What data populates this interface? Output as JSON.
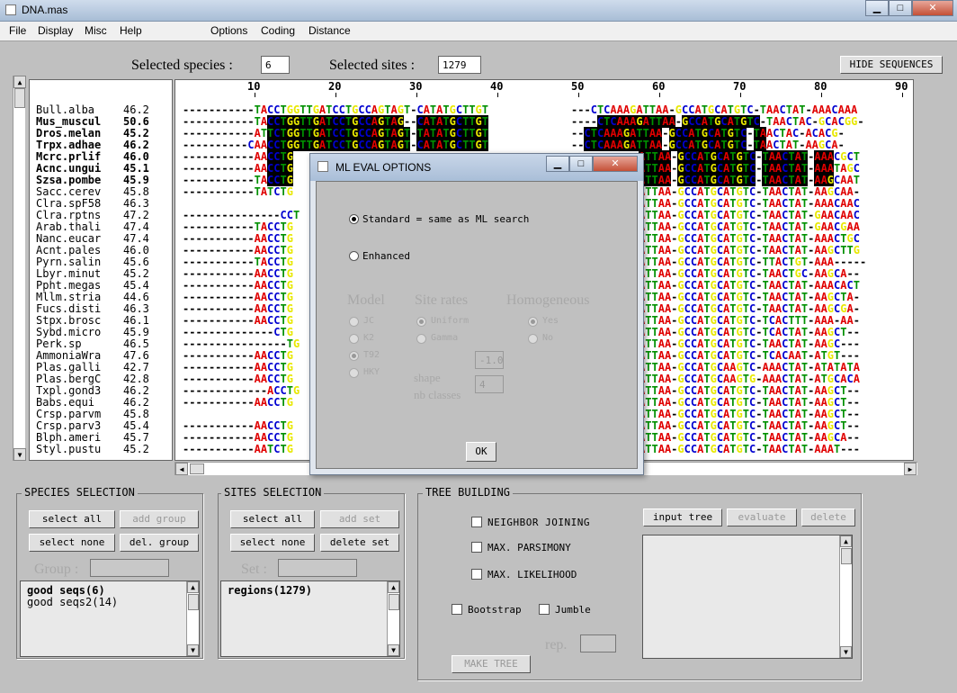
{
  "window": {
    "title": "DNA.mas",
    "minimize": "▁",
    "maximize": "□",
    "close": "✕"
  },
  "menu": {
    "items": [
      "File",
      "Display",
      "Misc",
      "Help",
      "Options",
      "Coding",
      "Distance"
    ]
  },
  "header": {
    "selected_species_label": "Selected species :",
    "selected_species_value": "6",
    "selected_sites_label": "Selected sites :",
    "selected_sites_value": "1279",
    "hide_sequences": "HIDE SEQUENCES"
  },
  "ruler": [
    "10",
    "20",
    "30",
    "40",
    "50",
    "60",
    "70",
    "80",
    "90"
  ],
  "species": [
    {
      "name": "Bull.alba",
      "score": "46.2",
      "bold": false
    },
    {
      "name": "Mus_muscul",
      "score": "50.6",
      "bold": true
    },
    {
      "name": "Dros.melan",
      "score": "45.2",
      "bold": true
    },
    {
      "name": "Trpx.adhae",
      "score": "46.2",
      "bold": true
    },
    {
      "name": "Mcrc.prlif",
      "score": "46.0",
      "bold": true
    },
    {
      "name": "Acnc.ungui",
      "score": "45.1",
      "bold": true
    },
    {
      "name": "Szsa.pombe",
      "score": "45.9",
      "bold": true
    },
    {
      "name": "Sacc.cerev",
      "score": "45.8",
      "bold": false
    },
    {
      "name": "Clra.spF58",
      "score": "46.3",
      "bold": false
    },
    {
      "name": "Clra.rptns",
      "score": "47.2",
      "bold": false
    },
    {
      "name": "Arab.thali",
      "score": "47.4",
      "bold": false
    },
    {
      "name": "Nanc.eucar",
      "score": "47.4",
      "bold": false
    },
    {
      "name": "Acnt.pales",
      "score": "46.0",
      "bold": false
    },
    {
      "name": "Pyrn.salin",
      "score": "45.6",
      "bold": false
    },
    {
      "name": "Lbyr.minut",
      "score": "45.2",
      "bold": false
    },
    {
      "name": "Ppht.megas",
      "score": "45.4",
      "bold": false
    },
    {
      "name": "Mllm.stria",
      "score": "44.6",
      "bold": false
    },
    {
      "name": "Fucs.disti",
      "score": "46.3",
      "bold": false
    },
    {
      "name": "Stpx.brosc",
      "score": "46.1",
      "bold": false
    },
    {
      "name": "Sybd.micro",
      "score": "45.9",
      "bold": false
    },
    {
      "name": "Perk.sp",
      "score": "46.5",
      "bold": false
    },
    {
      "name": "AmmoniaWra",
      "score": "47.6",
      "bold": false
    },
    {
      "name": "Plas.galli",
      "score": "42.7",
      "bold": false
    },
    {
      "name": "Plas.bergC",
      "score": "42.8",
      "bold": false
    },
    {
      "name": "Txpl.gond3",
      "score": "46.2",
      "bold": false
    },
    {
      "name": "Babs.equi",
      "score": "46.2",
      "bold": false
    },
    {
      "name": "Crsp.parvm",
      "score": "45.8",
      "bold": false
    },
    {
      "name": "Crsp.parv3",
      "score": "45.4",
      "bold": false
    },
    {
      "name": "Blph.ameri",
      "score": "45.7",
      "bold": false
    },
    {
      "name": "Styl.pustu",
      "score": "45.2",
      "bold": false
    }
  ],
  "sequences": {
    "left": [
      "-----------TACCTGGTTGATCCTGCCAGTAGT-CATATGCTTGT",
      "-----------TACCTGGTTGATCCTGCCAGTAG--CATATGCTTGT",
      "-----------ATTCTGGTTGATCCTGCCAGTAGT-TATATGCTTGT",
      "----------CAACCTGGTTGATCCTGCCAGTAGT-CATATGCTTGT",
      "-----------AACCTG",
      "-----------AACCTG",
      "-----------TACCTG",
      "-----------TATCTG",
      "",
      "---------------CCT",
      "-----------TACCTG",
      "-----------AACCTG",
      "-----------AACCTG",
      "-----------TACCTG",
      "-----------AACCTG",
      "-----------AACCTG",
      "-----------AACCTG",
      "-----------AACCTG",
      "-----------AACCTG",
      "--------------CTG",
      "----------------TG",
      "-----------AACCTG",
      "-----------AACCTG",
      "-----------AACCTG",
      "-------------ACCTG",
      "-----------AACCTG",
      "",
      "-----------AACCTG",
      "-----------AACCTG",
      "-----------AATCTG"
    ],
    "right": [
      "TTAA-GCCATGCATGTC-TAACTAT-AAACAAA",
      "GTTAA-GCCATGCATGTC-TAACTAC-GCACGG-",
      "GATTAA-GCCATGCATGTC-TAACTAC-ACACG-",
      "GATTAA-GCCATGCATGTC-TAACTAT-AAGCA-",
      "ATTAA-GCCATGCATGTC-TAACTAT-AAACGCT",
      "ATTAA-GCCATGCATGTC-TAACTAT-AAATAGC",
      "ATTAA-GCCATGCATGTC-TAACTAT-AAGCAAT",
      "ATTAA-GCCATGCATGTC-TAACTAT-AAGCAA-",
      "ATTAA-GCCATGCATGTC-TAACTAT-AAACAAC",
      "ATTAA-GCCATGCATGTC-TAACTAT-GAACAAC",
      "ATTAA-GCCATGCATGTC-TAACTAT-GAACGAA",
      "ATTAA-GCCATGCATGTC-TAACTAT-AAACTGC",
      "ATTAA-GCCATGCATGTC-TAACTAT-AAGCTTG",
      "ATTAA-GCCATGCATGTC-TTACTGT-AAA-----",
      "ATTAA-GCCATGCATGTC-TAACTGC-AAGCA--",
      "ATTAA-GCCATGCATGTC-TAACTAT-AAACACT",
      "ATTAA-GCCATGCATGTC-TAACTAT-AAGCTA-",
      "ATTAA-GCCATGCATGTC-TAACTAT-AAGCGA-",
      "ATTAA-GCCATGCATGTC-TCACTTT-AAA-AA-",
      "ATTAA-GCCATGCATGTC-TCACTAT-AAGCT--",
      "ATTAA-GCCATGCATGTC-TAACTAT-AAGC---",
      "ATTAA-GCCATGCATGTC-TCACAAT-ATGT---",
      "ATTAA-GCCATGCAAGTC-AAACTAT-ATATATA",
      "ATTAA-GCCATGCAAGTG-AAACTAT-ATGCACA",
      "ATTAA-GCCATGCATGTC-TAACTAT-AAGCT--",
      "ATTAA-GCCATGCATGTC-TAACTAT-AAGCT--",
      "ATTAA-GCCATGCATGTC-TAACTAT-AAGCT--",
      "ATTAA-GCCATGCATGTC-TAACTAT-AAGCT--",
      "ATTAA-GCCATGCATGTC-TAACTAT-AAGCA--",
      "ATTAA-GCCATGCATGTC-TAACTAT-AAAT---"
    ],
    "top_mid": [
      "---CTCAAAGATTAA-GCCATGCATGTC-TAACTAT-AAACAAA",
      "----CTCAAAGATTAA-GCCATGCATGTC-TAACTAC-GCACGG-",
      "--CTCAAAGATTAA-GCCATGCATGTC-TAACTAC-ACACG-",
      "--CTCAAAGATTAA-GCCATGCATGTC-TAACTAT-AAGCA-"
    ]
  },
  "dialog": {
    "title": "ML EVAL OPTIONS",
    "opt_standard": "Standard = same as ML search",
    "opt_enhanced": "Enhanced",
    "model_heading": "Model",
    "rates_heading": "Site rates",
    "homog_heading": "Homogeneous",
    "models": [
      "JC",
      "K2",
      "T92",
      "HKY"
    ],
    "rates": [
      "Uniform",
      "Gamma"
    ],
    "homog": [
      "Yes",
      "No"
    ],
    "shape_label": "shape",
    "shape_value": "-1.0",
    "nbclasses_label": "nb classes",
    "nbclasses_value": "4",
    "ok": "OK"
  },
  "species_sel": {
    "title": "SPECIES SELECTION",
    "select_all": "select all",
    "add_group": "add group",
    "select_none": "select none",
    "del_group": "del. group",
    "group_label": "Group :",
    "items": [
      "good seqs(6)",
      "good seqs2(14)"
    ]
  },
  "sites_sel": {
    "title": "SITES SELECTION",
    "select_all": "select all",
    "add_set": "add set",
    "select_none": "select none",
    "delete_set": "delete set",
    "set_label": "Set :",
    "items": [
      "regions(1279)"
    ]
  },
  "tree": {
    "title": "TREE BUILDING",
    "nj": "NEIGHBOR JOINING",
    "mp": "MAX. PARSIMONY",
    "ml": "MAX. LIKELIHOOD",
    "bootstrap": "Bootstrap",
    "jumble": "Jumble",
    "rep_label": "rep.",
    "make_tree": "MAKE TREE",
    "input_tree": "input tree",
    "evaluate": "evaluate",
    "delete": "delete"
  },
  "colors": {
    "A": "#e00000",
    "C": "#0000d0",
    "G": "#e8e800",
    "T": "#009000"
  }
}
